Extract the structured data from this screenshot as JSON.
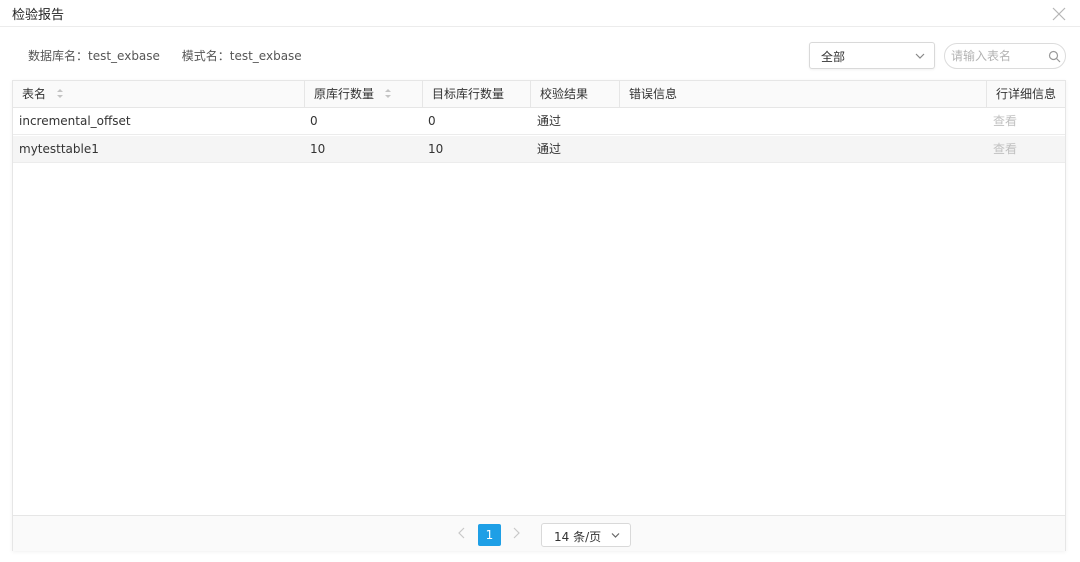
{
  "dialog": {
    "title": "检验报告"
  },
  "info": {
    "database_text": "数据库名：test_exbase",
    "schema_text": "模式名：test_exbase"
  },
  "filter": {
    "selected": "全部"
  },
  "search": {
    "placeholder": "请输入表名",
    "value": ""
  },
  "table": {
    "columns": [
      {
        "label": "表名"
      },
      {
        "label": "原库行数量"
      },
      {
        "label": "目标库行数量"
      },
      {
        "label": "校验结果"
      },
      {
        "label": "错误信息"
      },
      {
        "label": "行详细信息"
      }
    ],
    "rows": [
      {
        "name": "incremental_offset",
        "source_rows": "0",
        "target_rows": "0",
        "result": "通过",
        "error": "",
        "action": "查看"
      },
      {
        "name": "mytesttable1",
        "source_rows": "10",
        "target_rows": "10",
        "result": "通过",
        "error": "",
        "action": "查看"
      }
    ]
  },
  "pagination": {
    "current_page": "1",
    "page_size_label": "14 条/页"
  },
  "colors": {
    "accent": "#1e9fe6",
    "link_disabled": "#c0c0c0",
    "border": "#e6e6e6"
  }
}
